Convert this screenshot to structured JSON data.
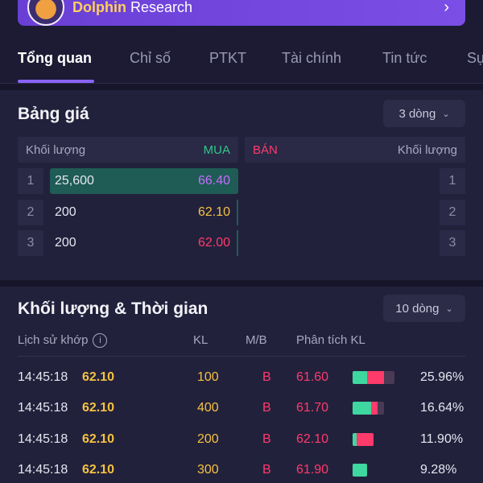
{
  "banner": {
    "brand": "Dolphin",
    "rest": " Research",
    "chevron": "›"
  },
  "tabs": [
    "Tổng quan",
    "Chỉ số",
    "PTKT",
    "Tài chính",
    "Tin tức",
    "Sự"
  ],
  "price_board": {
    "title": "Bảng giá",
    "dropdown": "3 dòng",
    "headers": {
      "buy_volume": "Khối lượng",
      "buy": "MUA",
      "sell": "BÁN",
      "sell_volume": "Khối lượng"
    },
    "rows": [
      {
        "idx": "1",
        "volume": "25,600",
        "price": "66.40",
        "sell_idx": "1",
        "bar": 1.0
      },
      {
        "idx": "2",
        "volume": "200",
        "price": "62.10",
        "sell_idx": "2",
        "bar": 0.0
      },
      {
        "idx": "3",
        "volume": "200",
        "price": "62.00",
        "sell_idx": "3",
        "bar": 0.0
      }
    ]
  },
  "time_sales": {
    "title": "Khối lượng & Thời gian",
    "dropdown": "10 dòng",
    "headers": {
      "history": "Lịch sử khớp",
      "info_icon": "i",
      "kl": "KL",
      "mb": "M/B",
      "analysis": "Phân tích KL"
    },
    "rows": [
      {
        "time": "14:45:18",
        "price": "62.10",
        "vol": "100",
        "side": "B",
        "level": "61.60",
        "pct": "25.96%",
        "bar": [
          0.35,
          0.4,
          0.25
        ]
      },
      {
        "time": "14:45:18",
        "price": "62.10",
        "vol": "400",
        "side": "B",
        "level": "61.70",
        "pct": "16.64%",
        "bar": [
          0.45,
          0.15,
          0.15
        ]
      },
      {
        "time": "14:45:18",
        "price": "62.10",
        "vol": "200",
        "side": "B",
        "level": "62.10",
        "pct": "11.90%",
        "bar": [
          0.1,
          0.4,
          0.0
        ]
      },
      {
        "time": "14:45:18",
        "price": "62.10",
        "vol": "300",
        "side": "B",
        "level": "61.90",
        "pct": "9.28%",
        "bar": [
          0.35,
          0.0,
          0.0
        ]
      }
    ]
  },
  "colors": {
    "accent": "#8a63ff",
    "buy": "#2ec98a",
    "sell": "#ff3b6b",
    "price": "#f5c242"
  }
}
